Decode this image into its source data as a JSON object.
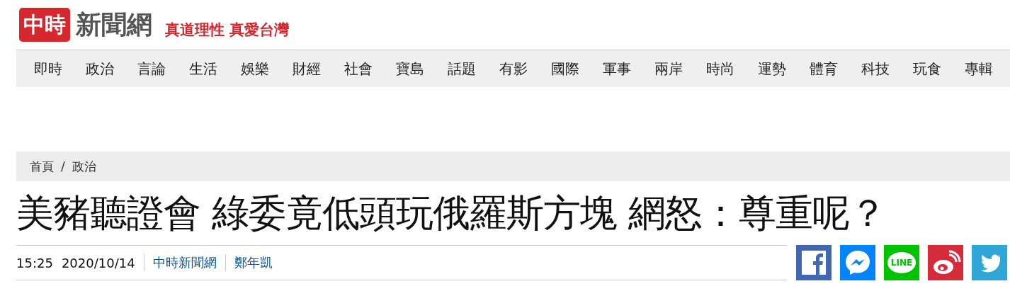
{
  "header": {
    "logo_mark": "中時",
    "logo_text": "新聞網",
    "slogan": "真道理性 真愛台灣"
  },
  "nav": [
    "即時",
    "政治",
    "言論",
    "生活",
    "娛樂",
    "財經",
    "社會",
    "寶島",
    "話題",
    "有影",
    "國際",
    "軍事",
    "兩岸",
    "時尚",
    "運勢",
    "體育",
    "科技",
    "玩食",
    "專輯"
  ],
  "breadcrumb": [
    "首頁",
    "政治"
  ],
  "breadcrumb_separator": "/",
  "headline": "美豬聽證會 綠委竟低頭玩俄羅斯方塊 網怒：尊重呢？",
  "meta": {
    "time": "15:25",
    "date": "2020/10/14",
    "source": "中時新聞網",
    "author": "鄭年凱"
  },
  "share": [
    {
      "kind": "facebook"
    },
    {
      "kind": "messenger"
    },
    {
      "kind": "line",
      "label": "LINE"
    },
    {
      "kind": "weibo"
    },
    {
      "kind": "twitter"
    }
  ]
}
